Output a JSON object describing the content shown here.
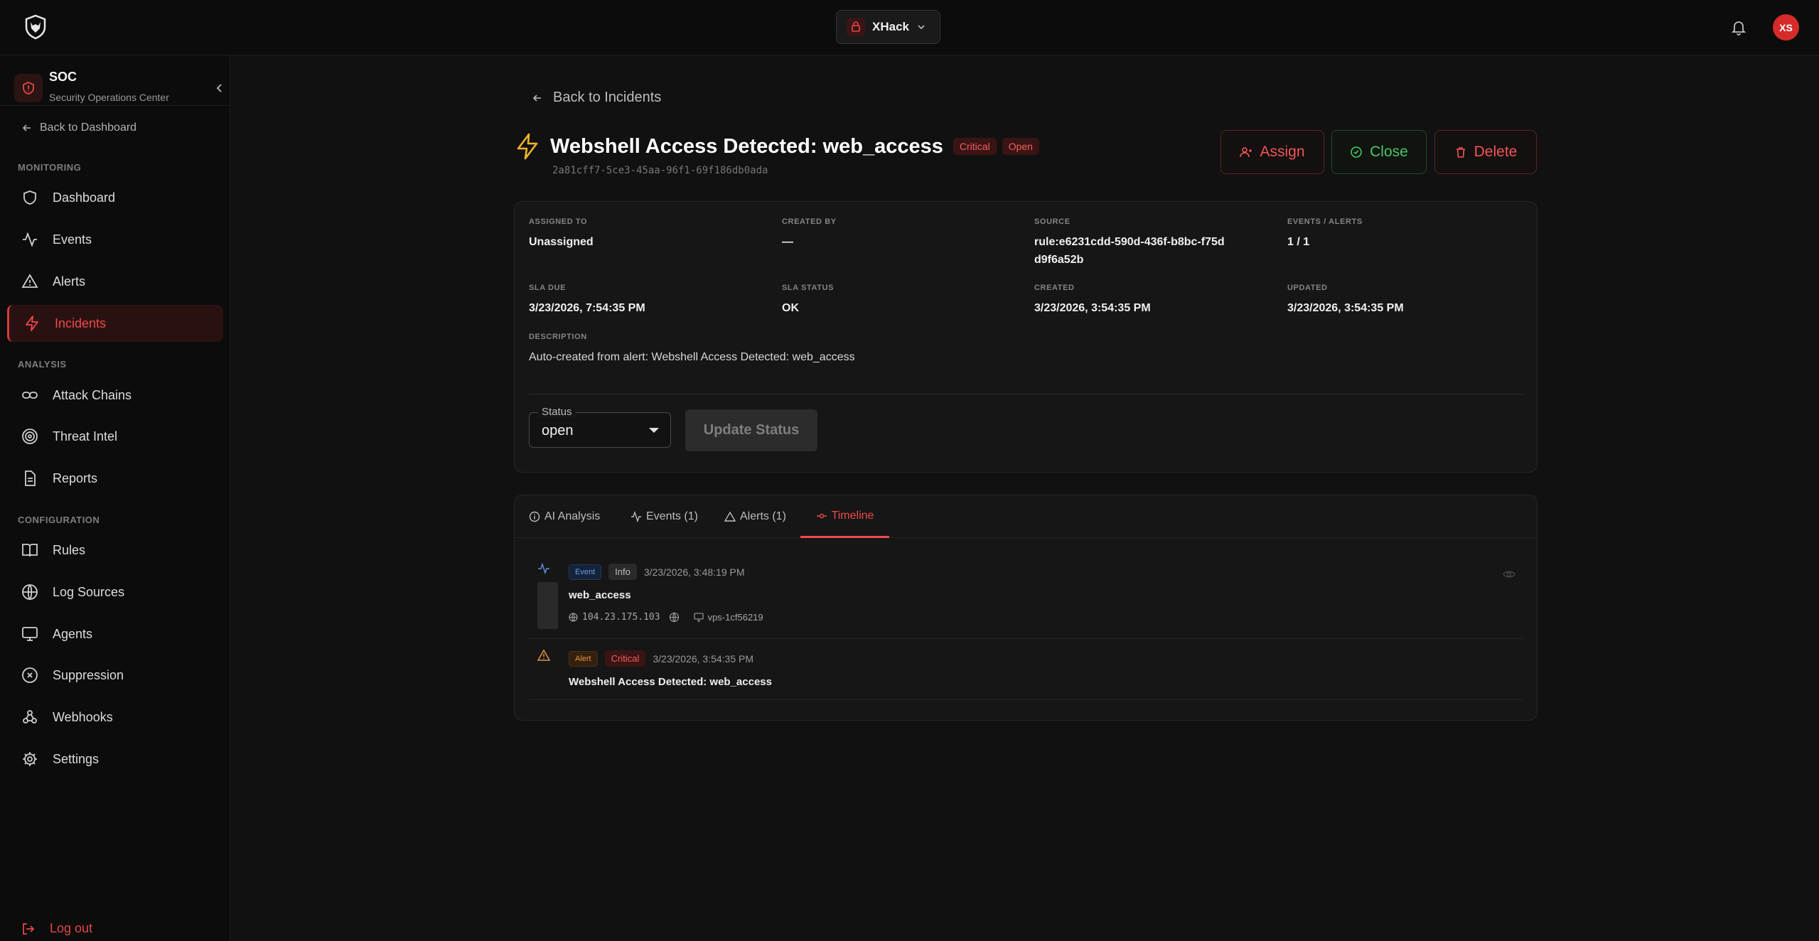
{
  "topbar": {
    "org_name": "XHack",
    "user_initials": "XS"
  },
  "sidebar": {
    "title": "SOC",
    "subtitle": "Security Operations Center",
    "back_label": "Back to Dashboard",
    "sections": {
      "monitoring": "MONITORING",
      "analysis": "ANALYSIS",
      "configuration": "CONFIGURATION"
    },
    "items": {
      "dashboard": "Dashboard",
      "events": "Events",
      "alerts": "Alerts",
      "incidents": "Incidents",
      "attack_chains": "Attack Chains",
      "threat_intel": "Threat Intel",
      "reports": "Reports",
      "rules": "Rules",
      "log_sources": "Log Sources",
      "agents": "Agents",
      "suppression": "Suppression",
      "webhooks": "Webhooks",
      "settings": "Settings"
    },
    "active_item": "incidents",
    "logout_label": "Log out"
  },
  "incident": {
    "back_label": "Back to Incidents",
    "title": "Webshell Access Detected: web_access",
    "severity_badge": "Critical",
    "status_badge": "Open",
    "id": "2a81cff7-5ce3-45aa-96f1-69f186db0ada",
    "actions": {
      "assign": "Assign",
      "close": "Close",
      "delete": "Delete"
    },
    "fields": {
      "assigned_to": {
        "label": "ASSIGNED TO",
        "value": "Unassigned"
      },
      "created_by": {
        "label": "CREATED BY",
        "value": "—"
      },
      "source": {
        "label": "SOURCE",
        "value": "rule:e6231cdd-590d-436f-b8bc-f75dd9f6a52b"
      },
      "events_alerts": {
        "label": "EVENTS / ALERTS",
        "value": "1 / 1"
      },
      "sla_due": {
        "label": "SLA DUE",
        "value": "3/23/2026, 7:54:35 PM"
      },
      "sla_status": {
        "label": "SLA STATUS",
        "value": "OK"
      },
      "created": {
        "label": "CREATED",
        "value": "3/23/2026, 3:54:35 PM"
      },
      "updated": {
        "label": "UPDATED",
        "value": "3/23/2026, 3:54:35 PM"
      },
      "description": {
        "label": "DESCRIPTION",
        "value": "Auto-created from alert: Webshell Access Detected: web_access"
      }
    },
    "status_control": {
      "legend": "Status",
      "value": "open",
      "update_button": "Update Status"
    }
  },
  "tabs": [
    {
      "label": "AI Analysis"
    },
    {
      "label": "Events (1)"
    },
    {
      "label": "Alerts (1)"
    },
    {
      "label": "Timeline"
    }
  ],
  "active_tab": "Timeline",
  "timeline": [
    {
      "kind": "Event",
      "level": "Info",
      "time": "3/23/2026, 3:48:19 PM",
      "title": "web_access",
      "ip": "104.23.175.103",
      "host": "vps-1cf56219"
    },
    {
      "kind": "Alert",
      "level": "Critical",
      "time": "3/23/2026, 3:54:35 PM",
      "title": "Webshell Access Detected: web_access"
    }
  ],
  "colors": {
    "accent": "#ef4a4a",
    "success": "#4cc565",
    "background": "#111111",
    "card": "#161616"
  }
}
